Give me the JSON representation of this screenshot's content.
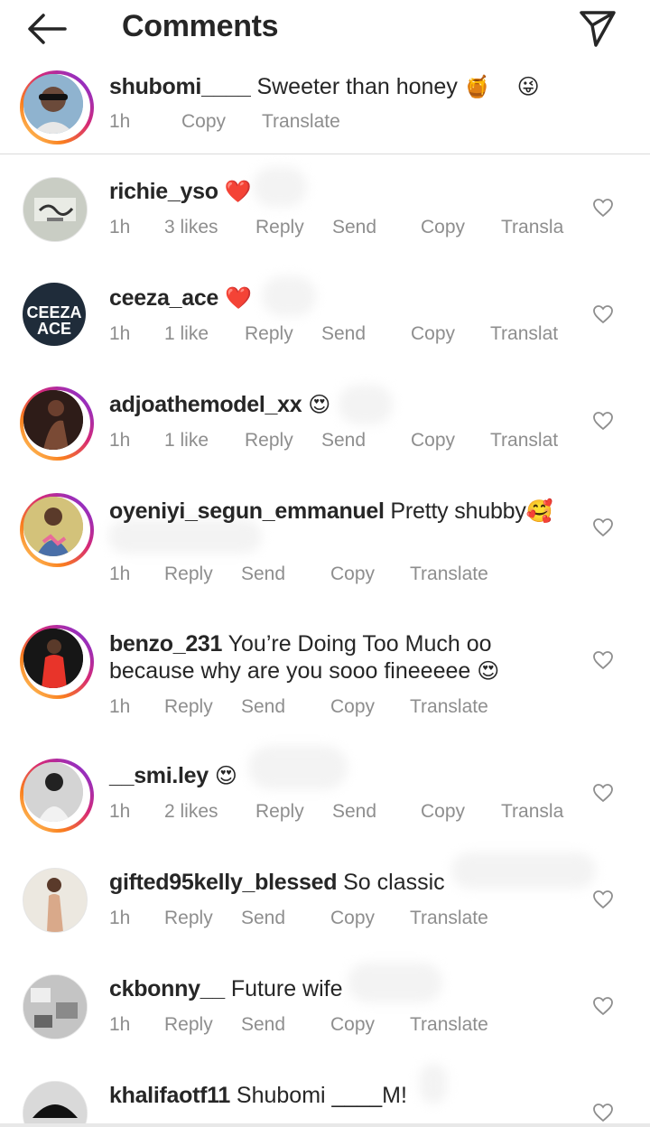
{
  "header": {
    "title": "Comments"
  },
  "comments": [
    {
      "user": "shubomi____",
      "text": "Sweeter than honey",
      "emoji1": "🍯",
      "emoji2": "😜",
      "time": "1h",
      "likes": "",
      "reply": "",
      "send": "",
      "copy": "Copy",
      "translate": "Translate"
    },
    {
      "user": "richie_yso",
      "text": "",
      "emoji1": "❤️",
      "time": "1h",
      "likes": "3 likes",
      "reply": "Reply",
      "send": "Send",
      "copy": "Copy",
      "translate": "Transla"
    },
    {
      "user": "ceeza_ace",
      "text": "",
      "emoji1": "❤️",
      "time": "1h",
      "likes": "1 like",
      "reply": "Reply",
      "send": "Send",
      "copy": "Copy",
      "translate": "Translat"
    },
    {
      "user": "adjoathemodel_xx",
      "text": "",
      "emoji1": "😍",
      "time": "1h",
      "likes": "1 like",
      "reply": "Reply",
      "send": "Send",
      "copy": "Copy",
      "translate": "Translat"
    },
    {
      "user": "oyeniyi_segun_emmanuel",
      "text": "Pretty shubby",
      "emoji1": "🥰",
      "time": "1h",
      "reply": "Reply",
      "send": "Send",
      "copy": "Copy",
      "translate": "Translate"
    },
    {
      "user": "benzo_231",
      "text": "You’re Doing Too Much oo",
      "text2": "because why are you sooo fineeeee",
      "emoji1": "😍",
      "time": "1h",
      "reply": "Reply",
      "send": "Send",
      "copy": "Copy",
      "translate": "Translate"
    },
    {
      "user": "__smi.ley",
      "text": "",
      "emoji1": "😍",
      "time": "1h",
      "likes": "2 likes",
      "reply": "Reply",
      "send": "Send",
      "copy": "Copy",
      "translate": "Transla"
    },
    {
      "user": "gifted95kelly_blessed",
      "text": "So classic",
      "time": "1h",
      "reply": "Reply",
      "send": "Send",
      "copy": "Copy",
      "translate": "Translate"
    },
    {
      "user": "ckbonny__",
      "text": "Future wife",
      "time": "1h",
      "reply": "Reply",
      "send": "Send",
      "copy": "Copy",
      "translate": "Translate"
    },
    {
      "user": "khalifaotf11",
      "text": "Shubomi ____M!"
    }
  ],
  "avatars": {
    "ceeza_line1": "CEEZA",
    "ceeza_line2": "ACE"
  },
  "colors": {
    "text": "#262626",
    "meta": "#8e8e8e",
    "divider": "#dbdbdb"
  }
}
